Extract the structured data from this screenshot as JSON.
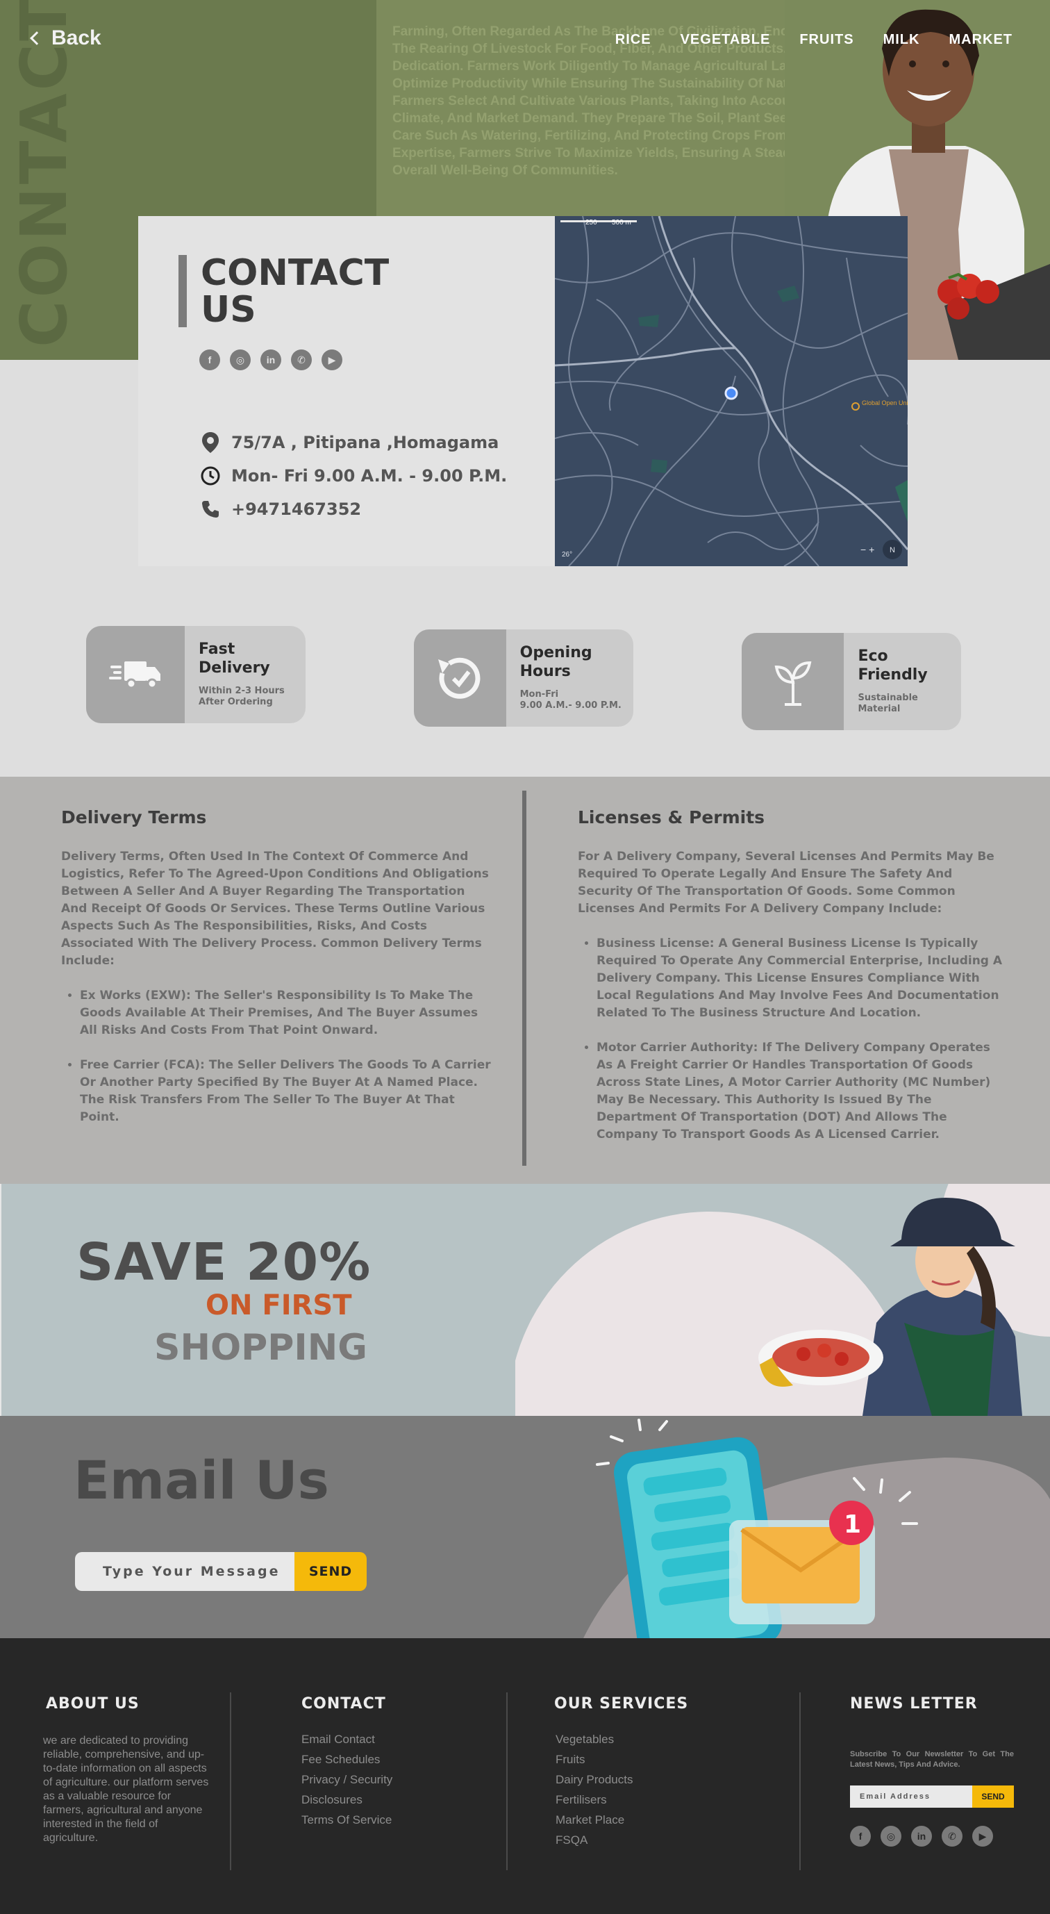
{
  "hero": {
    "vertical_text": "CONTACT US",
    "back_label": "Back",
    "body_text": "Farming, Often Regarded As The Backbone Of Civilization, Encompasses The Cultivation Of Crops And The Rearing Of Livestock For Food, Fiber, And Other Products. It Requires Knowledge, Skill, And Dedication. Farmers Work Diligently To Manage Agricultural Land, Employing A Range Of Techniques To Optimize Productivity While Ensuring The Sustainability Of Natural Resources. In Crop Farming, Farmers Select And Cultivate Various Plants, Taking Into Account Factors Like Soil Composition, Climate, And Market Demand. They Prepare The Soil, Plant Seeds Or Seedlings, And Provide Essential Care Such As Watering, Fertilizing, And Protecting Crops From Pests And Diseases. Through Their Expertise, Farmers Strive To Maximize Yields, Ensuring A Steady Food Supply And Contributing To The Overall Well-Being Of Communities.",
    "nav": [
      "RICE",
      "VEGETABLE",
      "FRUITS",
      "MILK",
      "MARKET"
    ]
  },
  "contact": {
    "title": "CONTACT US",
    "address": "75/7A , Pitipana ,Homagama",
    "hours": "Mon- Fri  9.00 A.M. - 9.00 P.M.",
    "phone": "+9471467352",
    "social": [
      "facebook-icon",
      "instagram-icon",
      "linkedin-icon",
      "whatsapp-icon",
      "youtube-icon"
    ]
  },
  "map": {
    "scale_a": "250",
    "scale_b": "500 m",
    "place_label": "Global Open University Town",
    "weather": "26°",
    "compass": "N"
  },
  "features": [
    {
      "title": "Fast Delivery",
      "sub": "Within 2-3 Hours\nAfter Ordering",
      "icon": "truck-icon"
    },
    {
      "title": "Opening Hours",
      "sub": "Mon-Fri\n9.00 A.M.- 9.00 P.M.",
      "icon": "clock-icon"
    },
    {
      "title": "Eco Friendly",
      "sub": "Sustainable\nMaterial",
      "icon": "sprout-icon"
    }
  ],
  "terms": {
    "delivery_title": "Delivery Terms",
    "delivery_intro": "Delivery Terms, Often Used In The Context Of Commerce And Logistics, Refer To The Agreed-Upon Conditions And Obligations Between A Seller And A Buyer Regarding The Transportation And Receipt Of Goods Or Services. These Terms Outline Various Aspects Such As The Responsibilities, Risks, And Costs Associated With The Delivery Process. Common Delivery Terms Include:",
    "delivery_items": [
      "Ex Works (EXW): The Seller's Responsibility Is To Make The Goods Available At Their Premises, And The Buyer Assumes All Risks And Costs From That Point Onward.",
      "Free Carrier (FCA): The Seller Delivers The Goods To A Carrier Or Another Party Specified By The Buyer At A Named Place. The Risk Transfers From The Seller To The Buyer At That Point."
    ],
    "license_title": "Licenses & Permits",
    "license_intro": "For A Delivery Company, Several Licenses And Permits May Be Required To Operate Legally And Ensure The Safety And Security Of The Transportation Of Goods. Some Common Licenses And Permits For A Delivery Company Include:",
    "license_items": [
      "Business License: A General Business License Is Typically Required To Operate Any Commercial Enterprise, Including A Delivery Company. This License Ensures Compliance With Local Regulations And May Involve Fees And Documentation Related To The Business Structure And Location.",
      "Motor Carrier Authority: If The Delivery Company Operates As A Freight Carrier Or Handles Transportation Of Goods Across State Lines, A Motor Carrier Authority (MC Number) May Be Necessary. This Authority Is Issued By The Department Of Transportation (DOT) And Allows The Company To Transport Goods As A Licensed Carrier."
    ]
  },
  "promo": {
    "line1": "SAVE 20%",
    "line2": "ON FIRST",
    "line3": "SHOPPING"
  },
  "email": {
    "title": "Email Us",
    "placeholder": "Type Your Message",
    "send": "SEND",
    "badge": "1"
  },
  "footer": {
    "about_title": "ABOUT US",
    "about_text": "we are dedicated to providing reliable, comprehensive, and up-to-date information on all aspects of agriculture. our platform serves as a valuable resource for farmers, agricultural  and anyone interested in the field of agriculture.",
    "contact_title": "CONTACT",
    "contact_links": [
      "Email Contact",
      "Fee Schedules",
      "Privacy / Security",
      "Disclosures",
      "Terms Of Service"
    ],
    "services_title": "OUR SERVICES",
    "services_links": [
      "Vegetables",
      "Fruits",
      "Dairy Products",
      "Fertilisers",
      "Market Place",
      "FSQA"
    ],
    "news_title": "NEWS LETTER",
    "news_text": "Subscribe To Our Newsletter To Get The Latest News, Tips And Advice.",
    "news_placeholder": "Email Address",
    "news_send": "SEND"
  }
}
